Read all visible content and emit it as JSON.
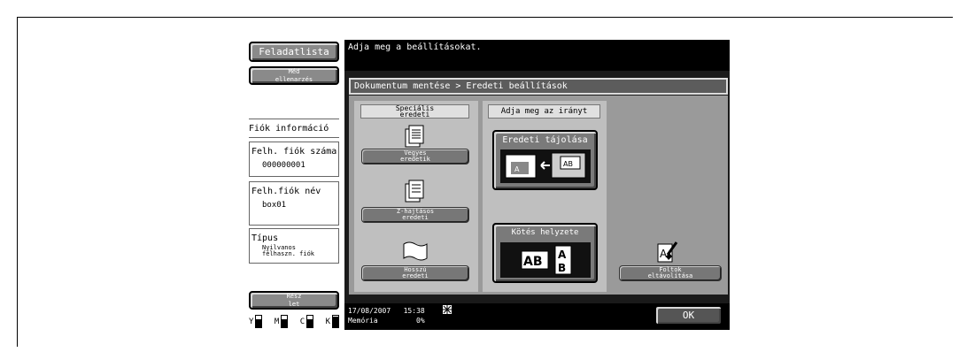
{
  "left_panel": {
    "job_list_button": "Feladatlista",
    "proof_button": "Méd\nellenarzés",
    "account_info_title": "Fiók információ",
    "account_number_label": "Felh. fiók száma",
    "account_number_value": "000000001",
    "account_name_label": "Felh.fiók név",
    "account_name_value": "box01",
    "type_label": "Típus",
    "type_value": "Nyilvanos\nfélhaszn. fiók",
    "details_button": "Rész\nlet",
    "toner": [
      {
        "letter": "Y",
        "level": 0.7
      },
      {
        "letter": "M",
        "level": 0.7
      },
      {
        "letter": "C",
        "level": 0.7
      },
      {
        "letter": "K",
        "level": 0.9
      }
    ]
  },
  "message": "Adja meg a beállításokat.",
  "breadcrumb": "Dokumentum mentése > Eredeti beállítások",
  "special_originals": {
    "header": "Speciális\neredeti",
    "mixed_button": "Vegyes\neredetik",
    "zfold_button": "Z-hajtásos\neredeti",
    "long_button": "Hosszú\neredeti"
  },
  "direction": {
    "header": "Adja meg az irányt",
    "orientation_label": "Eredeti tájolása",
    "binding_label": "Kötés helyzete"
  },
  "remove_stains_button": "Foltok\neltávolítása",
  "status_bar": {
    "datetime": "17/08/2007   15:38",
    "memory_label": "Memória",
    "memory_value": "0%"
  },
  "ok_button": "OK",
  "colors": {
    "accent": "#8a8a8a",
    "dark": "#000000",
    "panel": "#bfbfbf"
  }
}
